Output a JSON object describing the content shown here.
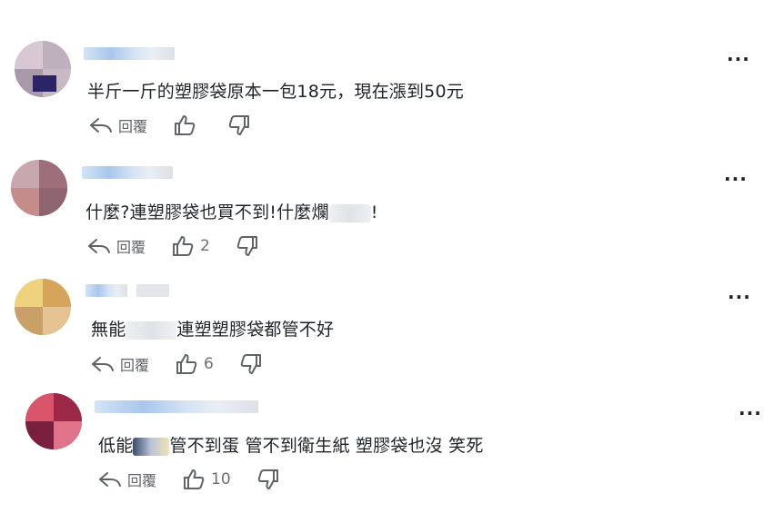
{
  "comments": [
    {
      "text": "半斤一斤的塑膠袋原本一包18元，現在漲到50元",
      "reply_label": "回覆",
      "like_count": "",
      "more": "..."
    },
    {
      "text_a": "什麼?連塑膠袋也買不到!什麼爛",
      "text_b": "!",
      "reply_label": "回覆",
      "like_count": "2",
      "more": "..."
    },
    {
      "text_a": "無能",
      "text_b": "連塑塑膠袋都管不好",
      "reply_label": "回覆",
      "like_count": "6",
      "more": "..."
    },
    {
      "text_a": "低能",
      "text_b": "管不到蛋 管不到衛生紙 塑膠袋也沒 笑死",
      "reply_label": "回覆",
      "like_count": "10",
      "more": "..."
    }
  ],
  "icons": {
    "reply": "reply-arrow-icon",
    "like": "thumbs-up-icon",
    "dislike": "thumbs-down-icon",
    "more": "more-options-icon"
  }
}
